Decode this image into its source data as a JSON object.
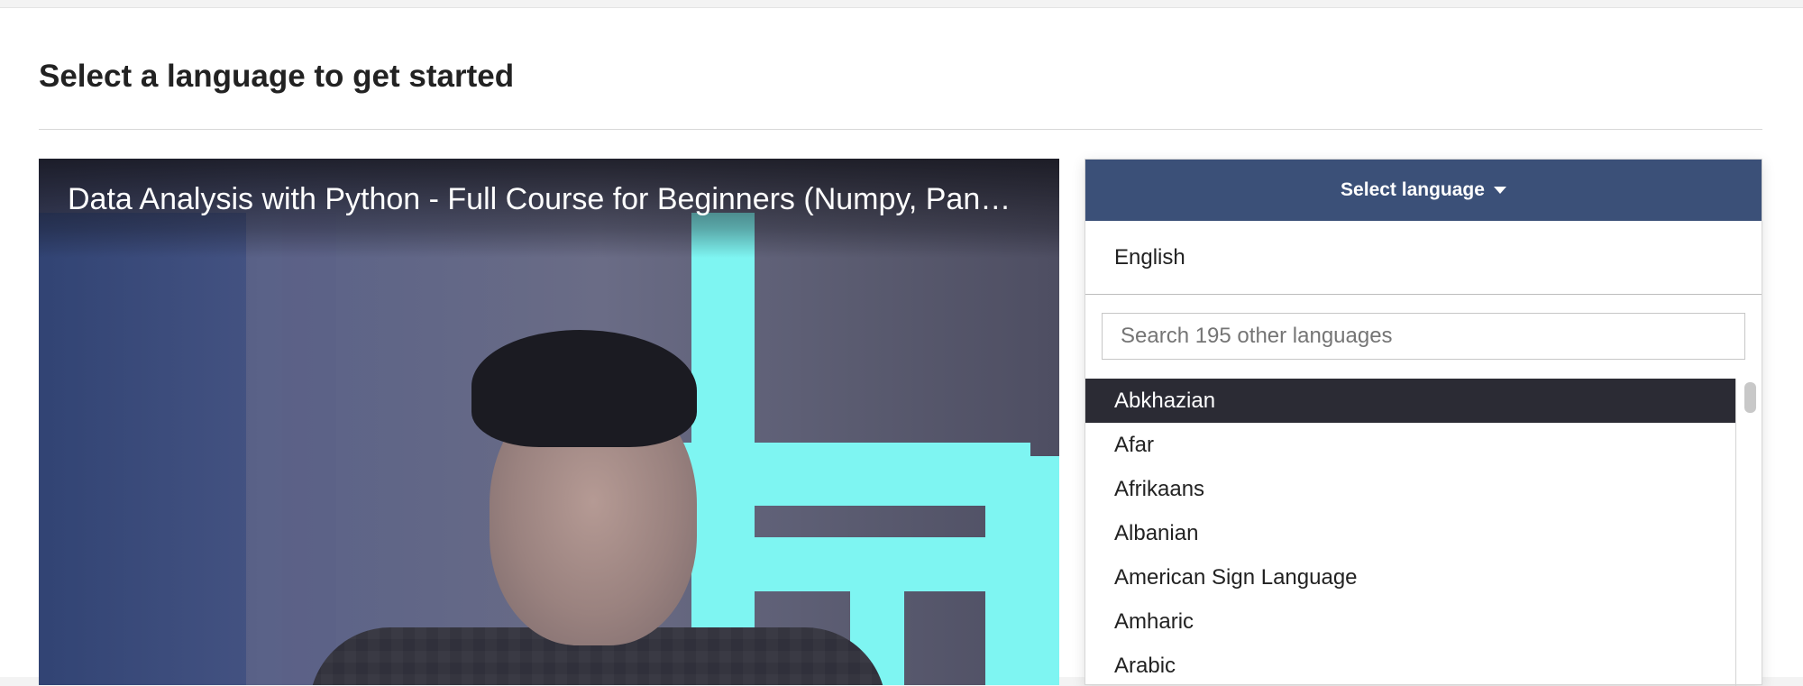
{
  "page": {
    "title": "Select a language to get started"
  },
  "video": {
    "title": "Data Analysis with Python - Full Course for Beginners (Numpy, Pan…"
  },
  "language_selector": {
    "header_label": "Select language",
    "current_language": "English",
    "search": {
      "value": "",
      "placeholder": "Search 195 other languages"
    },
    "languages": [
      "Abkhazian",
      "Afar",
      "Afrikaans",
      "Albanian",
      "American Sign Language",
      "Amharic",
      "Arabic"
    ],
    "highlighted_index": 0
  },
  "colors": {
    "header_bg": "#3b5078",
    "active_item_bg": "#2b2b34",
    "accent_cyan": "#7ef5f2"
  },
  "icons": {
    "dropdown": "caret-down-icon"
  }
}
